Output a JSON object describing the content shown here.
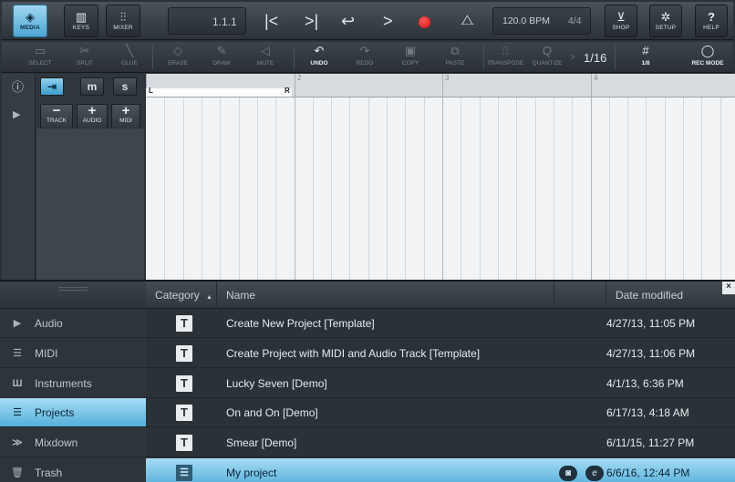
{
  "topbar": {
    "tabs": [
      {
        "label": "MEDIA",
        "icon": "media-icon",
        "selected": true
      },
      {
        "label": "KEYS",
        "icon": "keys-icon",
        "selected": false
      },
      {
        "label": "MIXER",
        "icon": "mixer-icon",
        "selected": false
      }
    ],
    "position": "1.1.1",
    "tempo": "120.0 BPM",
    "time_signature": "4/4",
    "right_buttons": [
      {
        "label": "SHOP",
        "icon": "cart-icon"
      },
      {
        "label": "SETUP",
        "icon": "gear-icon"
      },
      {
        "label": "HELP",
        "icon": "help-icon"
      }
    ]
  },
  "toolbar": {
    "tools": [
      {
        "label": "SELECT",
        "icon": "select-icon",
        "enabled": false
      },
      {
        "label": "SPLIT",
        "icon": "split-icon",
        "enabled": false
      },
      {
        "label": "GLUE",
        "icon": "glue-icon",
        "enabled": false
      },
      {
        "label": "ERASE",
        "icon": "erase-icon",
        "enabled": false
      },
      {
        "label": "DRAW",
        "icon": "draw-icon",
        "enabled": false
      },
      {
        "label": "MUTE",
        "icon": "mute-icon",
        "enabled": false
      },
      {
        "label": "UNDO",
        "icon": "undo-icon",
        "enabled": true
      },
      {
        "label": "REDO",
        "icon": "redo-icon",
        "enabled": false
      },
      {
        "label": "COPY",
        "icon": "copy-icon",
        "enabled": false
      },
      {
        "label": "PASTE",
        "icon": "paste-icon",
        "enabled": false
      },
      {
        "label": "TRANSPOSE",
        "icon": "transpose-icon",
        "enabled": false
      },
      {
        "label": "QUANTIZE",
        "icon": "quantize-icon",
        "enabled": false
      }
    ],
    "quantize_value": "1/16",
    "grid": {
      "label": "1/8",
      "icon": "grid-icon"
    },
    "rec_mode": {
      "label": "REC MODE",
      "icon": "rec-mode-icon"
    }
  },
  "track_header": {
    "buttons": [
      "m",
      "s"
    ],
    "add_buttons": [
      "TRACK",
      "AUDIO",
      "MIDI"
    ]
  },
  "ruler": {
    "bars": [
      "2",
      "3",
      "4"
    ],
    "loop_left": "L",
    "loop_right": "R"
  },
  "browser": {
    "categories": [
      {
        "label": "Audio",
        "icon": "play-triangle-icon",
        "selected": false
      },
      {
        "label": "MIDI",
        "icon": "midi-icon",
        "selected": false
      },
      {
        "label": "Instruments",
        "icon": "instruments-icon",
        "selected": false
      },
      {
        "label": "Projects",
        "icon": "projects-icon",
        "selected": true
      },
      {
        "label": "Mixdown",
        "icon": "mixdown-icon",
        "selected": false
      },
      {
        "label": "Trash",
        "icon": "trash-icon",
        "selected": false
      }
    ],
    "columns": {
      "category": "Category",
      "sort_indicator": "▲",
      "name": "Name",
      "date": "Date modified"
    },
    "files": [
      {
        "icon": "T",
        "name": "Create New Project [Template]",
        "date": "4/27/13, 11:05 PM",
        "selected": false
      },
      {
        "icon": "T",
        "name": "Create Project with MIDI and Audio Track [Template]",
        "date": "4/27/13, 11:06 PM",
        "selected": false
      },
      {
        "icon": "T",
        "name": "Lucky Seven [Demo]",
        "date": "4/1/13, 6:36 PM",
        "selected": false
      },
      {
        "icon": "T",
        "name": "On and On [Demo]",
        "date": "6/17/13, 4:18 AM",
        "selected": false
      },
      {
        "icon": "T",
        "name": "Smear [Demo]",
        "date": "6/11/15, 11:27 PM",
        "selected": false
      },
      {
        "icon": "☰",
        "name": "My project",
        "date": "6/6/16, 12:44 PM",
        "selected": true
      }
    ]
  },
  "colors": {
    "accent": "#55afd9",
    "record": "#d00b0b",
    "background": "#2b3238"
  }
}
